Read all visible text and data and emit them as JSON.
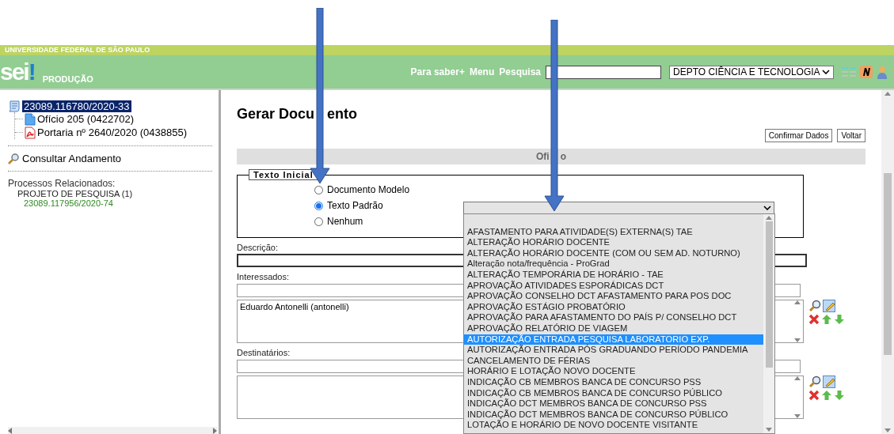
{
  "header": {
    "institution": "UNIVERSIDADE FEDERAL DE SÃO PAULO",
    "logo": {
      "word": "sei",
      "mark": "!"
    },
    "environment": "PRODUÇÃO",
    "links": [
      "Para saber+",
      "Menu",
      "Pesquisa"
    ],
    "unit_select": {
      "value": "DEPTO CIÊNCIA E TECNOLOGIA"
    }
  },
  "tree": {
    "label": "23089.116780/2020-33",
    "selected": true,
    "children": [
      {
        "label": "Ofício 205 (0422702)",
        "kind": "document"
      },
      {
        "label": "Portaria nº 2640/2020 (0438855)",
        "kind": "pdf"
      }
    ]
  },
  "consult_link": "Consultar Andamento",
  "related": {
    "title": "Processos Relacionados:",
    "groups": [
      {
        "label": "PROJETO DE PESQUISA (1)",
        "items": [
          "23089.117956/2020-74"
        ]
      }
    ]
  },
  "form": {
    "title_parts": [
      "Gerar Docu",
      "ento"
    ],
    "buttons": [
      "Confirmar Dados",
      "Voltar"
    ],
    "section_title_parts": [
      "Ofi",
      "o"
    ],
    "initial_text": {
      "legend": "Texto Inicial",
      "options": [
        {
          "label": "Documento Modelo",
          "selected": false
        },
        {
          "label": "Texto Padrão",
          "selected": true
        },
        {
          "label": "Nenhum",
          "selected": false
        }
      ]
    },
    "description": {
      "label": "Descrição:"
    },
    "interested": {
      "label": "Interessados:",
      "entries": [
        "Eduardo Antonelli (antonelli)"
      ]
    },
    "recipients": {
      "label": "Destinatários:"
    }
  },
  "model_dropdown": {
    "options": [
      {
        "label": "AFASTAMENTO PARA ATIVIDADE(S) EXTERNA(S) TAE",
        "selected": false
      },
      {
        "label": "ALTERAÇÃO HORÁRIO DOCENTE",
        "selected": false
      },
      {
        "label": "ALTERAÇÃO HORÁRIO DOCENTE (COM OU SEM AD. NOTURNO)",
        "selected": false
      },
      {
        "label": "Alteração nota/frequência - ProGrad",
        "selected": false
      },
      {
        "label": "ALTERAÇÃO TEMPORÁRIA DE HORÁRIO - TAE",
        "selected": false
      },
      {
        "label": "APROVAÇÃO ATIVIDADES ESPORÁDICAS DCT",
        "selected": false
      },
      {
        "label": "APROVAÇÃO CONSELHO DCT AFASTAMENTO PARA POS DOC",
        "selected": false
      },
      {
        "label": "APROVAÇÃO ESTÁGIO PROBATÓRIO",
        "selected": false
      },
      {
        "label": "APROVAÇÃO PARA AFASTAMENTO DO PAÍS P/ CONSELHO DCT",
        "selected": false
      },
      {
        "label": "APROVAÇÃO RELATÓRIO DE VIAGEM",
        "selected": false
      },
      {
        "label": "AUTORIZAÇÃO ENTRADA PESQUISA LABORATORIO EXP.",
        "selected": true
      },
      {
        "label": "AUTORIZAÇÃO ENTRADA PÓS GRADUANDO PERÍODO PANDEMIA",
        "selected": false
      },
      {
        "label": "CANCELAMENTO DE FÉRIAS",
        "selected": false
      },
      {
        "label": "HORÁRIO E LOTAÇÃO NOVO DOCENTE",
        "selected": false
      },
      {
        "label": "INDICAÇÃO CB MEMBROS BANCA DE CONCURSO PSS",
        "selected": false
      },
      {
        "label": "INDICAÇÃO CB MEMBROS BANCA DE CONCURSO PÚBLICO",
        "selected": false
      },
      {
        "label": "INDICAÇÃO DCT MEMBROS BANCA DE CONCURSO PSS",
        "selected": false
      },
      {
        "label": "INDICAÇÃO DCT MEMBROS BANCA DE CONCURSO PÚBLICO",
        "selected": false
      },
      {
        "label": "LOTAÇÃO E HORÁRIO DE NOVO DOCENTE VISITANTE",
        "selected": false
      }
    ]
  }
}
